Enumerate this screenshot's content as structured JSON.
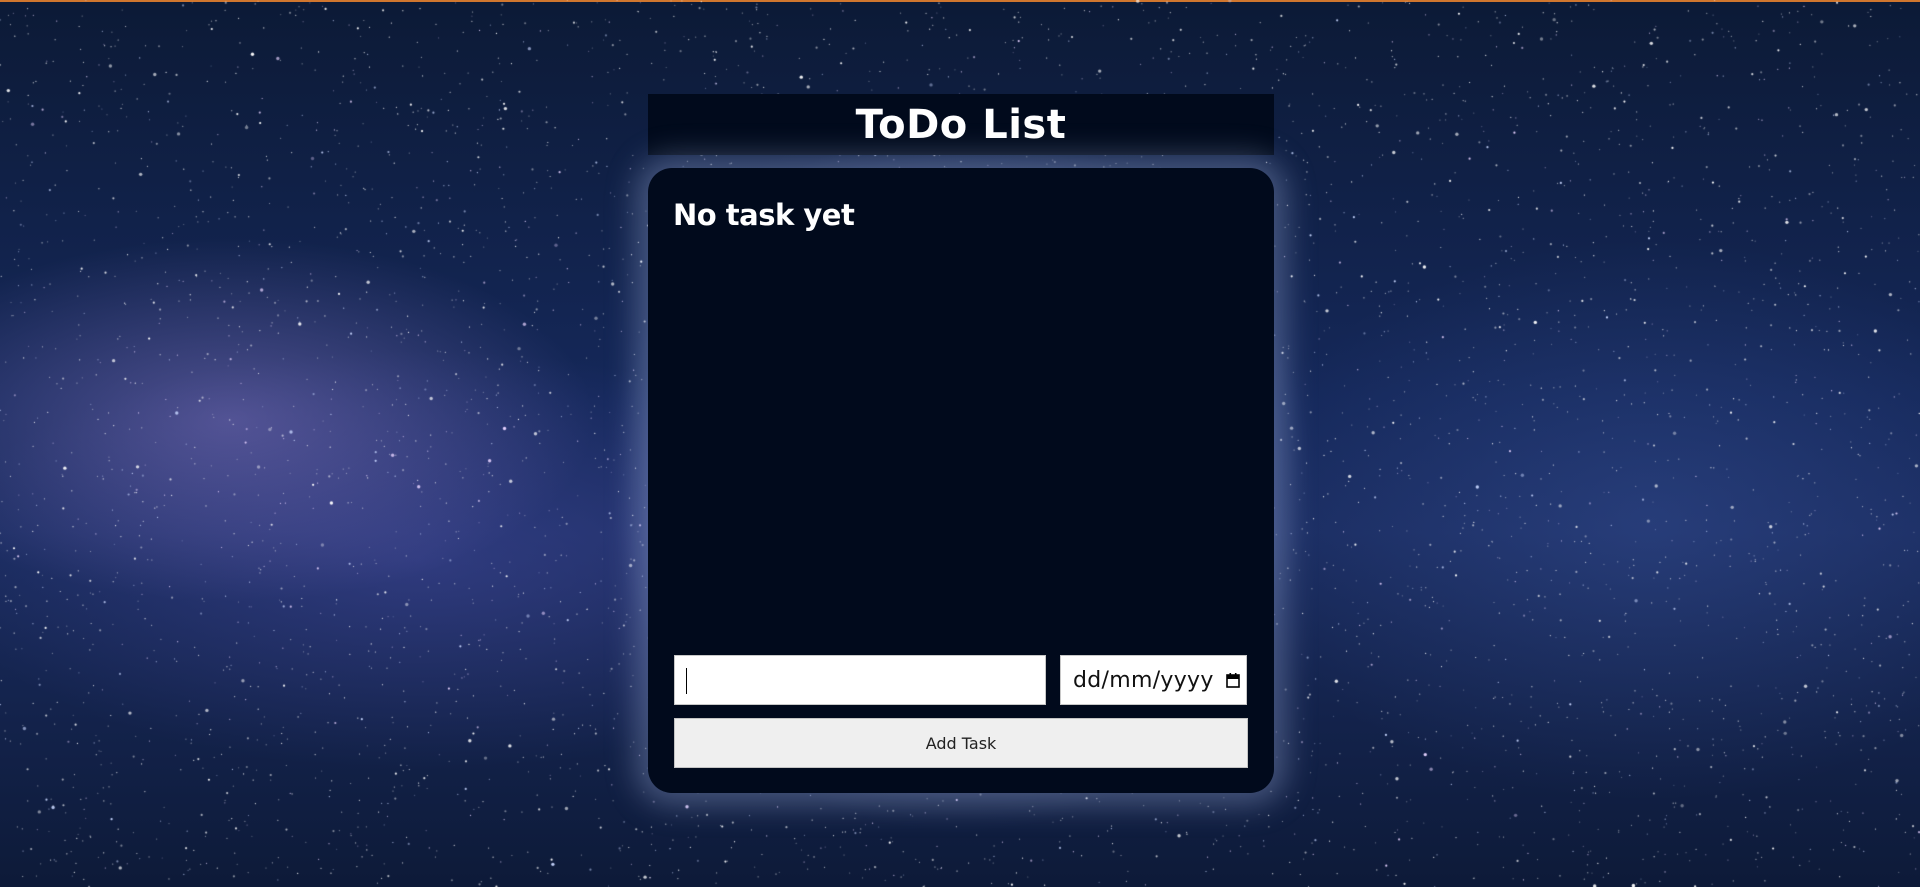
{
  "app": {
    "title": "ToDo List"
  },
  "tasks": {
    "empty_message": "No task yet",
    "items": []
  },
  "form": {
    "task_input_value": "",
    "date_placeholder": "dd/mm/yyyy",
    "add_button_label": "Add Task"
  },
  "icons": {
    "date_picker": "calendar-icon"
  },
  "colors": {
    "panel_background": "#010a1c",
    "title_text": "#ffffff",
    "button_background": "#efefef",
    "top_accent": "#d0762e"
  }
}
